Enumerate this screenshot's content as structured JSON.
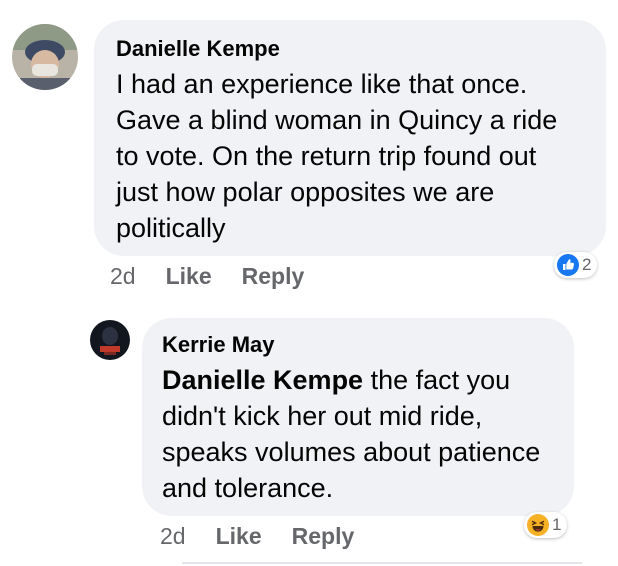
{
  "comments": [
    {
      "author": "Danielle Kempe",
      "text": "I had an experience like that once. Gave a blind woman in Quincy a ride to vote. On the return trip found out just how polar opposites we are politically",
      "time": "2d",
      "like_label": "Like",
      "reply_label": "Reply",
      "reaction": {
        "icon": "like-reaction-icon",
        "count": "2",
        "color": "#1877f2"
      }
    },
    {
      "author": "Kerrie May",
      "mention": "Danielle Kempe",
      "text": " the fact you didn't kick her out mid ride, speaks volumes about patience and tolerance.",
      "time": "2d",
      "like_label": "Like",
      "reply_label": "Reply",
      "reaction": {
        "icon": "haha-reaction-icon",
        "count": "1",
        "color": "#f7b125"
      }
    }
  ]
}
